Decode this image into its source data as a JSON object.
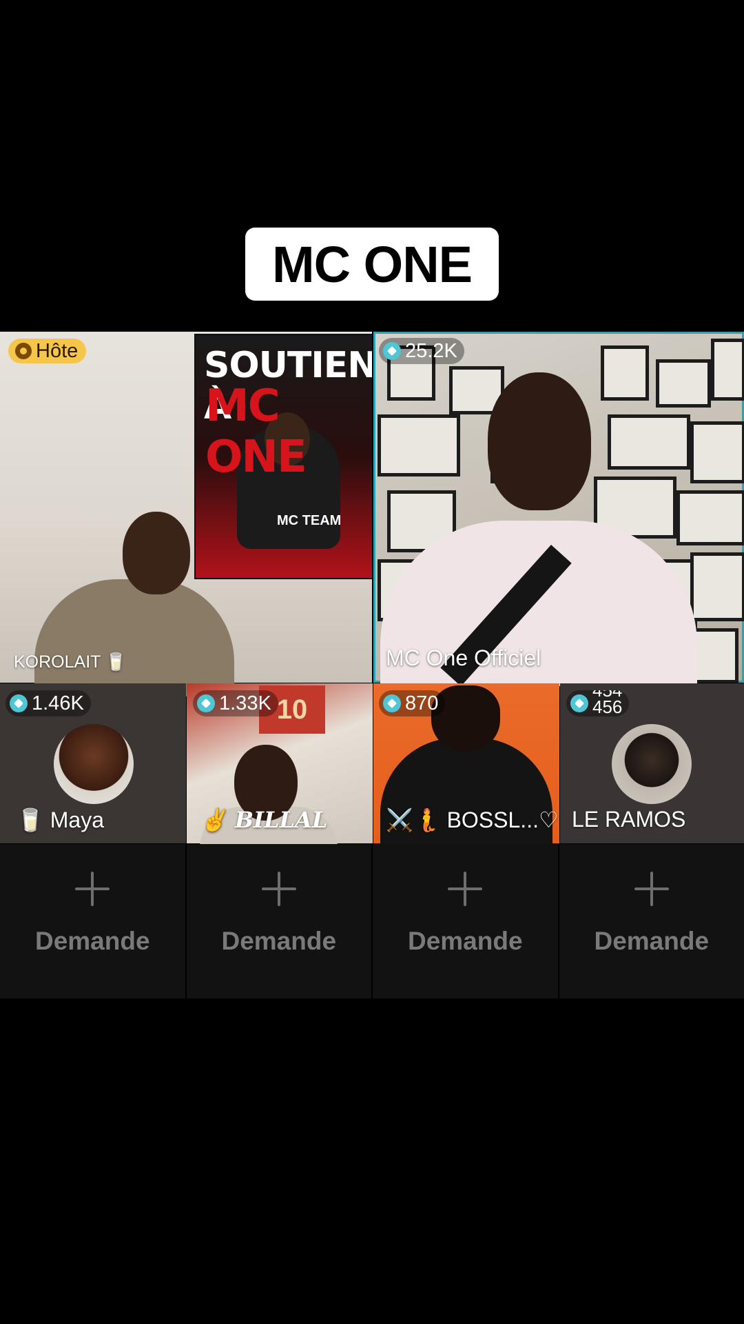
{
  "title": "MC ONE",
  "host_tile": {
    "role_badge": "Hôte",
    "name": "KOROLAIT 🥛",
    "poster": {
      "line1": "SOUTIEN À",
      "line2": "MC ONE",
      "team": "MC TEAM"
    }
  },
  "main_tile": {
    "count": "25.2K",
    "name": "MC One Officiel",
    "accent_color": "#25a6b8"
  },
  "guests": [
    {
      "count": "1.46K",
      "name": "🥛 Maya"
    },
    {
      "count": "1.33K",
      "name": "✌ BILLAL"
    },
    {
      "count": "870",
      "name": "⚔️🧜 BOSSL...♡"
    },
    {
      "count": "454\n456",
      "name": "LE RAMOS"
    }
  ],
  "requests": [
    {
      "label": "Demande"
    },
    {
      "label": "Demande"
    },
    {
      "label": "Demande"
    },
    {
      "label": "Demande"
    }
  ],
  "icons": {
    "gem": "gem-icon",
    "host": "host-icon",
    "add": "plus-icon"
  },
  "colors": {
    "gem": "#4ec6d6",
    "host_badge": "#f5c64a",
    "background": "#000000"
  }
}
